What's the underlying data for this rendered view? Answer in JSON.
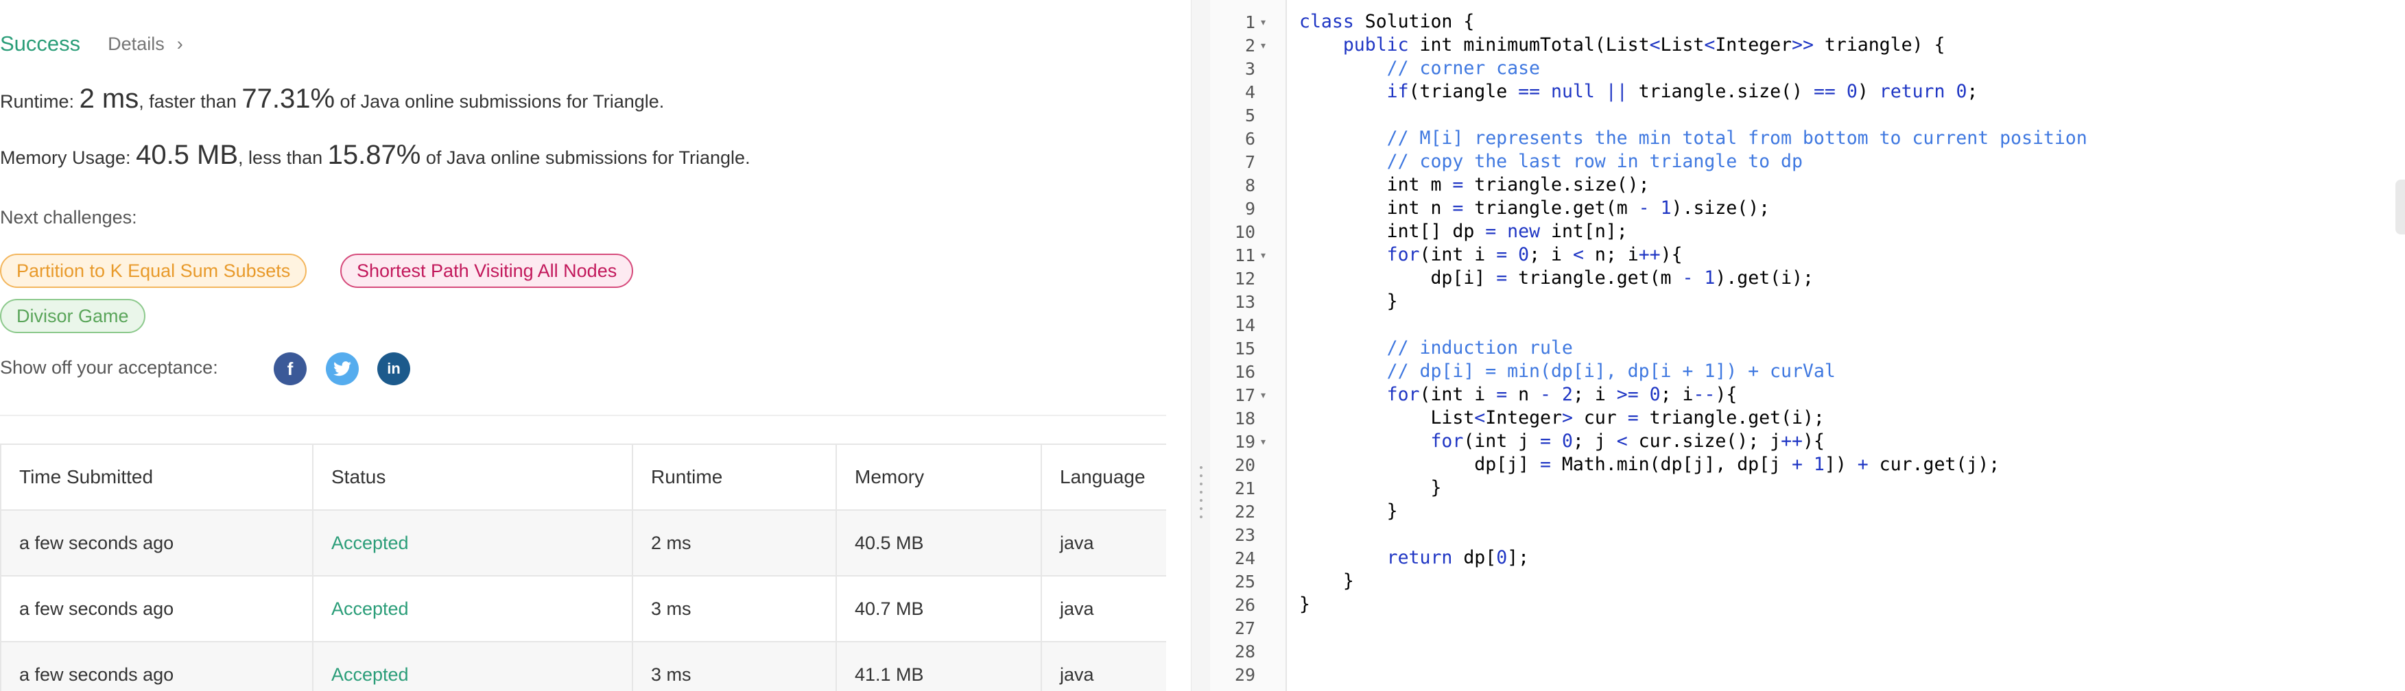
{
  "result": {
    "status": "Success",
    "details_label": "Details",
    "details_chevron": "›"
  },
  "runtime": {
    "label": "Runtime:",
    "value": "2 ms",
    "mid": ", faster than",
    "percent": "77.31%",
    "suffix": "of Java online submissions for Triangle."
  },
  "memory": {
    "label": "Memory Usage:",
    "value": "40.5 MB",
    "mid": ", less than",
    "percent": "15.87%",
    "suffix": "of Java online submissions for Triangle."
  },
  "challenges": {
    "label": "Next challenges:",
    "items": [
      "Partition to K Equal Sum Subsets",
      "Shortest Path Visiting All Nodes",
      "Divisor Game"
    ]
  },
  "share": {
    "label": "Show off your acceptance:",
    "icons": [
      "facebook-icon",
      "twitter-icon",
      "linkedin-icon"
    ],
    "glyphs": [
      "f",
      "t",
      "in"
    ]
  },
  "submissions": {
    "headers": [
      "Time Submitted",
      "Status",
      "Runtime",
      "Memory",
      "Language"
    ],
    "rows": [
      [
        "a few seconds ago",
        "Accepted",
        "2 ms",
        "40.5 MB",
        "java"
      ],
      [
        "a few seconds ago",
        "Accepted",
        "3 ms",
        "40.7 MB",
        "java"
      ],
      [
        "a few seconds ago",
        "Accepted",
        "3 ms",
        "41.1 MB",
        "java"
      ]
    ]
  },
  "editor": {
    "line_numbers": [
      "1",
      "2",
      "3",
      "4",
      "5",
      "6",
      "7",
      "8",
      "9",
      "10",
      "11",
      "12",
      "13",
      "14",
      "15",
      "16",
      "17",
      "18",
      "19",
      "20",
      "21",
      "22",
      "23",
      "24",
      "25",
      "26",
      "27",
      "28",
      "29"
    ],
    "fold_lines": [
      1,
      2,
      11,
      17,
      19
    ],
    "lines": [
      "class Solution {",
      "    public int minimumTotal(List<List<Integer>> triangle) {",
      "        // corner case",
      "        if(triangle == null || triangle.size() == 0) return 0;",
      "",
      "        // M[i] represents the min total from bottom to current position",
      "        // copy the last row in triangle to dp",
      "        int m = triangle.size();",
      "        int n = triangle.get(m - 1).size();",
      "        int[] dp = new int[n];",
      "        for(int i = 0; i < n; i++){",
      "            dp[i] = triangle.get(m - 1).get(i);",
      "        }",
      "",
      "        // induction rule",
      "        // dp[i] = min(dp[i], dp[i + 1]) + curVal",
      "        for(int i = n - 2; i >= 0; i--){",
      "            List<Integer> cur = triangle.get(i);",
      "            for(int j = 0; j < cur.size(); j++){",
      "                dp[j] = Math.min(dp[j], dp[j + 1]) + cur.get(j);",
      "            }",
      "        }",
      "",
      "        return dp[0];",
      "    }",
      "}",
      "",
      "",
      ""
    ]
  },
  "colors": {
    "success": "#2a9d78",
    "keyword": "#1f36c4",
    "comment": "#3f78e0"
  }
}
